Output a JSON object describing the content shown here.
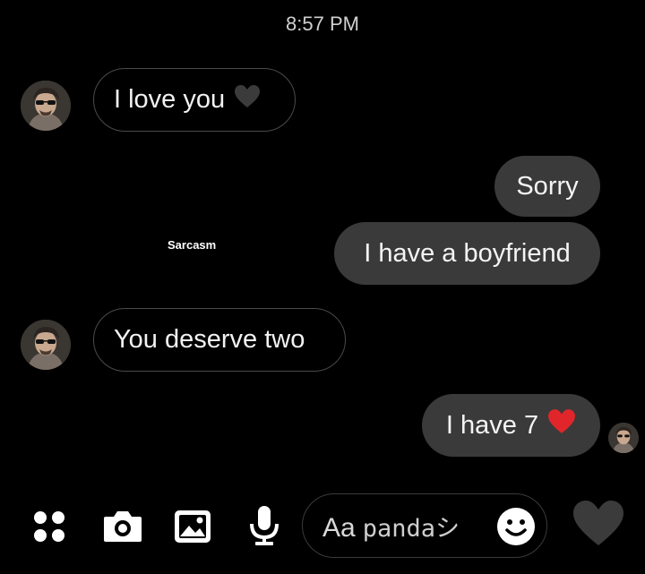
{
  "status": {
    "time": "8:57 PM"
  },
  "messages": [
    {
      "direction": "incoming",
      "text": "I love you",
      "emoji": "black-heart-icon"
    },
    {
      "direction": "outgoing",
      "text": "Sorry"
    },
    {
      "direction": "outgoing",
      "text": "I have a boyfriend"
    },
    {
      "direction": "incoming",
      "text": "You deserve two"
    },
    {
      "direction": "outgoing",
      "text": "I have 7",
      "emoji": "red-heart-icon"
    }
  ],
  "caption": "Sarcasm",
  "composer": {
    "aa": "Aa",
    "typed": "pandaシ"
  },
  "toolbar": [
    "apps-icon",
    "camera-icon",
    "gallery-icon",
    "microphone-icon"
  ],
  "colors": {
    "background": "#000000",
    "outgoing_bubble": "#3a3a3a",
    "incoming_border": "#4a4a4a",
    "red_heart": "#e0262b",
    "black_heart": "#3b3b3b"
  }
}
